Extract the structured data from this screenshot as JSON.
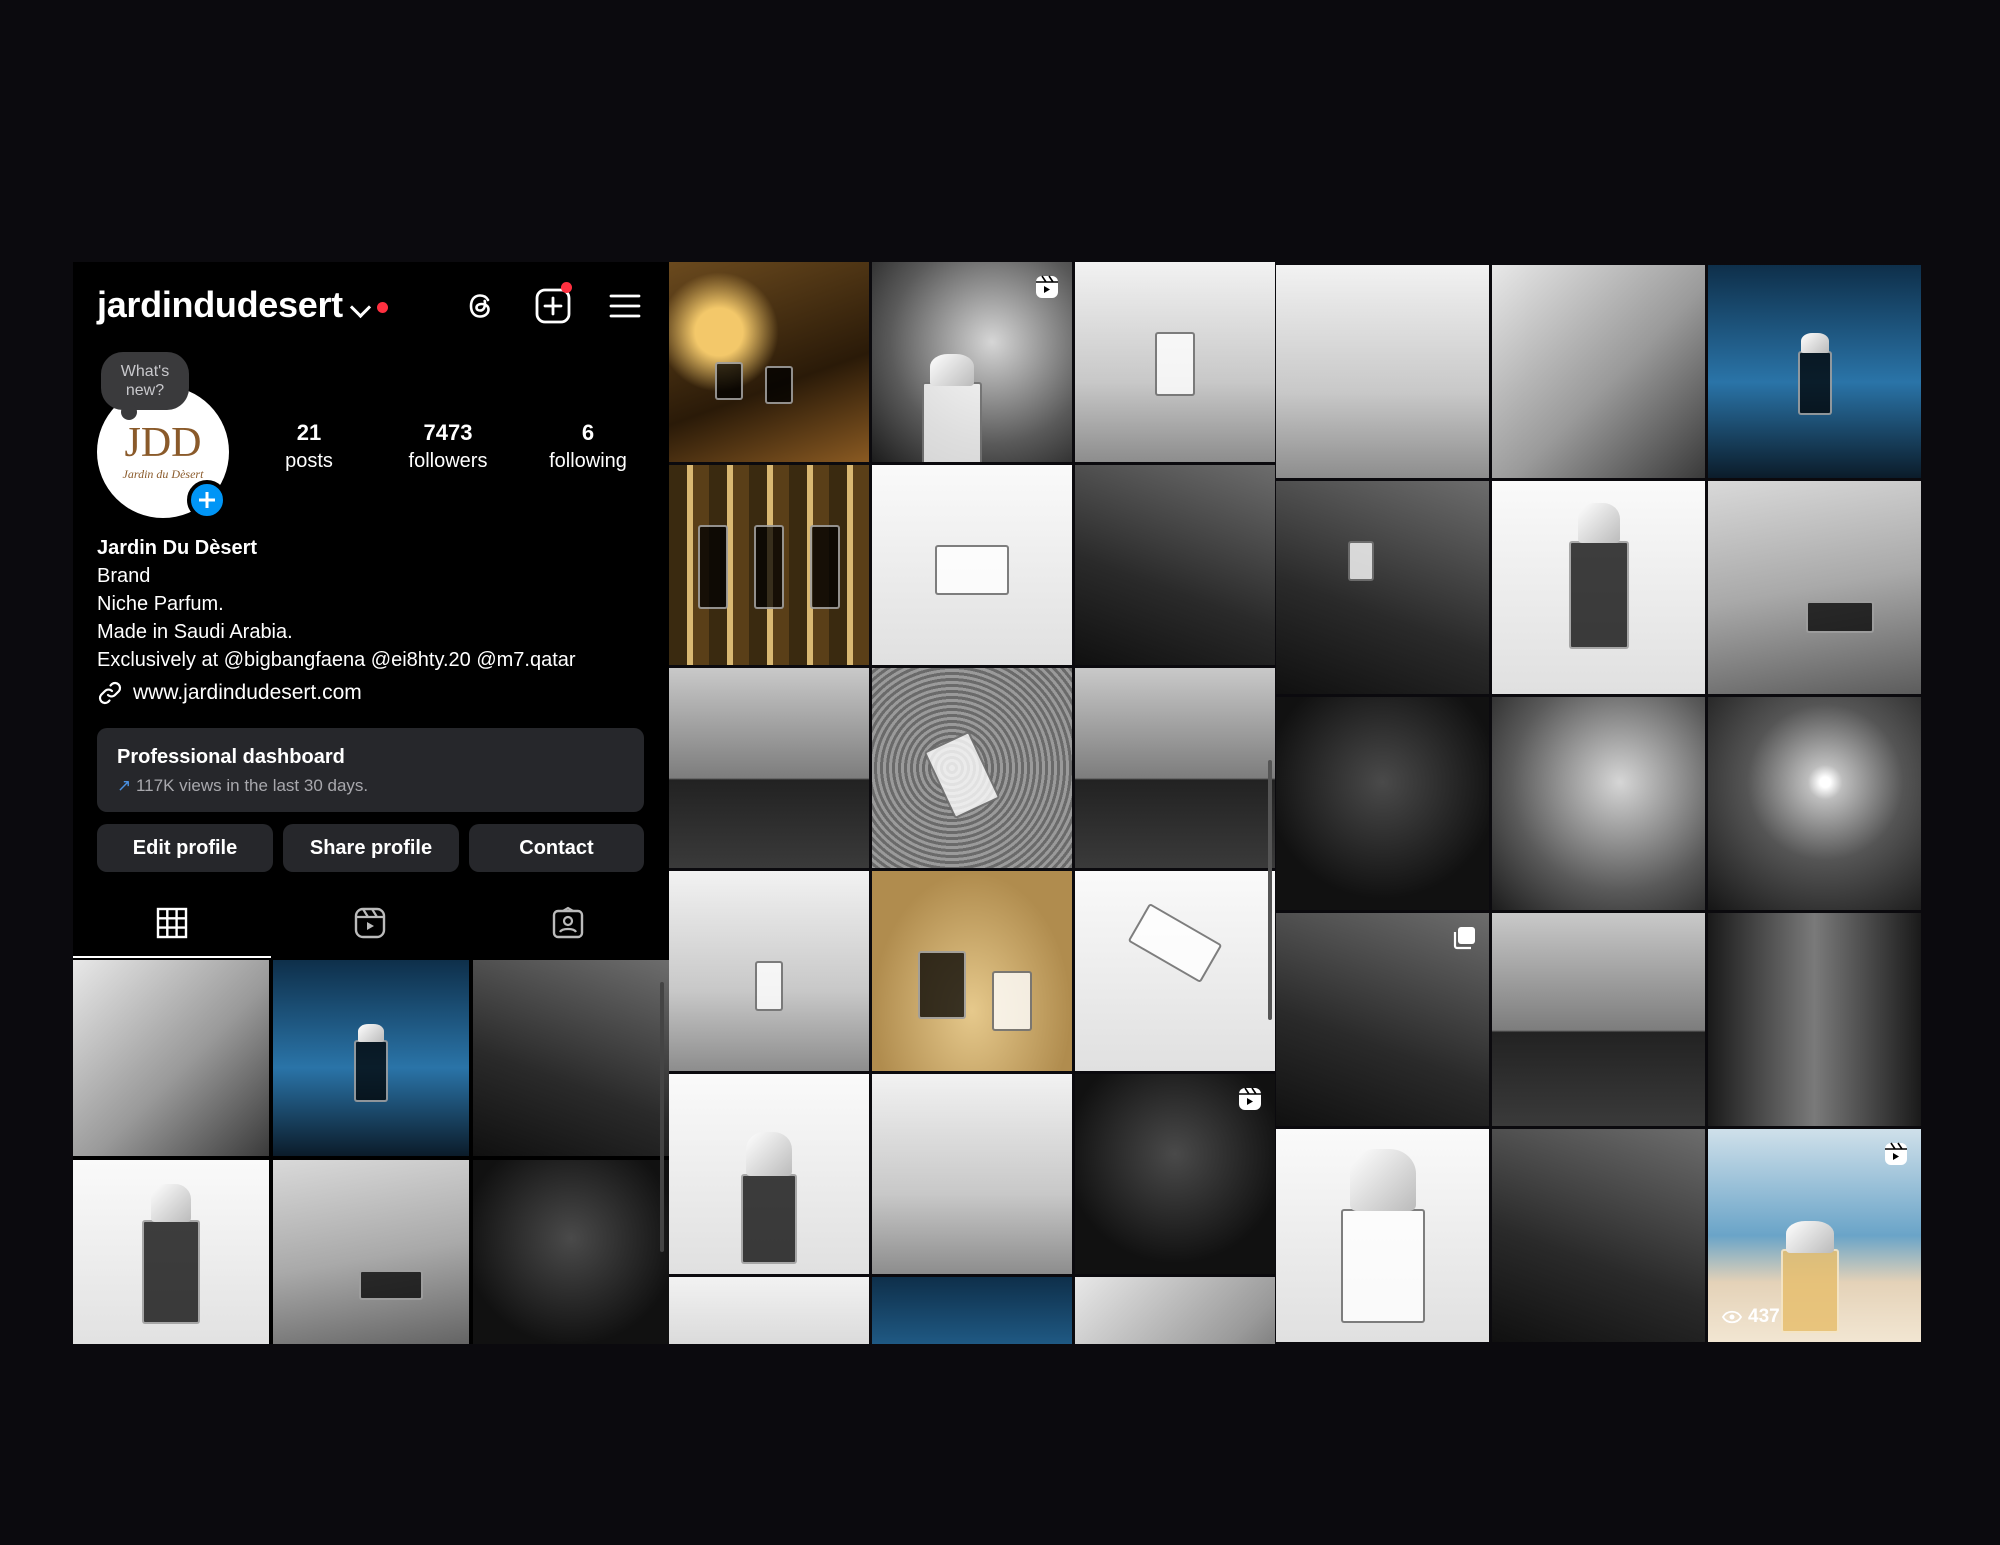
{
  "profile": {
    "username": "jardindudesert",
    "bubble_text": "What's new?",
    "avatar_logo": "JDD",
    "avatar_sub": "Jardin du Dèsert",
    "stats": {
      "posts": {
        "value": "21",
        "label": "posts"
      },
      "followers": {
        "value": "7473",
        "label": "followers"
      },
      "following": {
        "value": "6",
        "label": "following"
      }
    },
    "name": "Jardin Du Dèsert",
    "category": "Brand",
    "bio_lines": [
      "Niche Parfum.",
      "Made in Saudi Arabia.",
      "Exclusively at @bigbangfaena @ei8hty.20 @m7.qatar"
    ],
    "website": "www.jardindudesert.com",
    "dashboard": {
      "title": "Professional dashboard",
      "subtitle": "117K views in the last 30 days."
    },
    "buttons": {
      "edit": "Edit profile",
      "share": "Share profile",
      "contact": "Contact"
    }
  },
  "icons": {
    "threads": "threads-icon",
    "create": "create-icon",
    "menu": "menu-icon",
    "grid": "grid-icon",
    "reels": "reels-icon",
    "tagged": "tagged-icon",
    "link": "link-icon",
    "reel_badge": "reel-icon",
    "carousel_badge": "carousel-icon",
    "views": "eye-icon"
  },
  "reel_views": "437",
  "colors": {
    "background": "#0b0a0e",
    "panel": "#000000",
    "button": "#26272b",
    "accent_blue": "#0095f6",
    "notification_red": "#ff3040"
  }
}
